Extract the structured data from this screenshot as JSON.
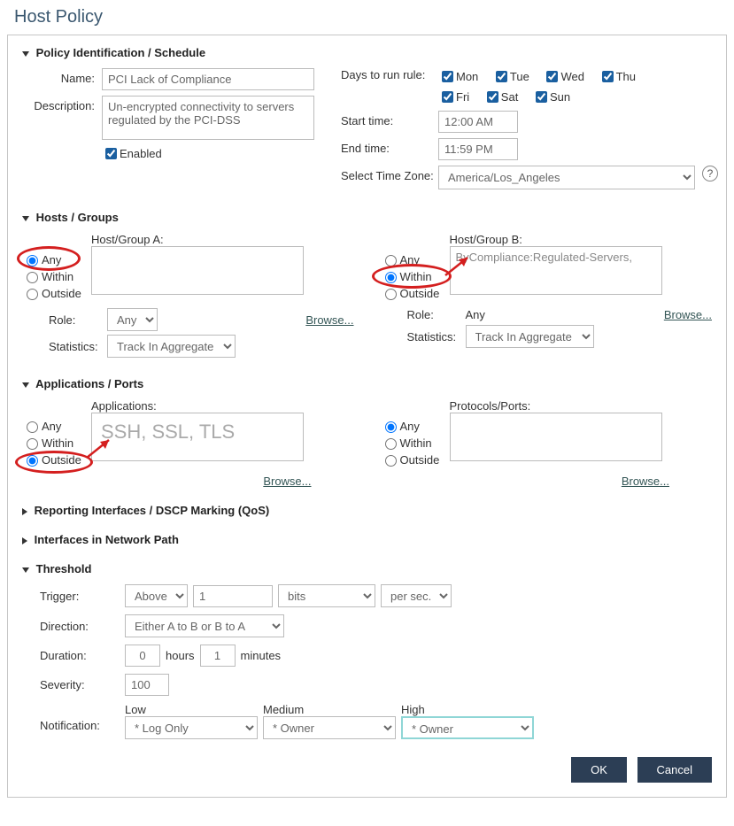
{
  "page_title": "Host Policy",
  "sections": {
    "identification": "Policy Identification / Schedule",
    "hosts": "Hosts / Groups",
    "apps": "Applications / Ports",
    "reporting": "Reporting Interfaces / DSCP Marking (QoS)",
    "interfaces": "Interfaces in Network Path",
    "threshold": "Threshold"
  },
  "identification": {
    "name_label": "Name:",
    "name_value": "PCI Lack of Compliance",
    "description_label": "Description:",
    "description_value": "Un-encrypted connectivity to servers regulated by the PCI-DSS",
    "enabled_label": "Enabled",
    "days_label": "Days to run rule:",
    "days": {
      "mon": "Mon",
      "tue": "Tue",
      "wed": "Wed",
      "thu": "Thu",
      "fri": "Fri",
      "sat": "Sat",
      "sun": "Sun"
    },
    "start_label": "Start time:",
    "start_value": "12:00 AM",
    "end_label": "End time:",
    "end_value": "11:59 PM",
    "tz_label": "Select Time Zone:",
    "tz_value": "America/Los_Angeles"
  },
  "hosts": {
    "groupA_label": "Host/Group A:",
    "groupB_label": "Host/Group B:",
    "groupB_value": "ByCompliance:Regulated-Servers,",
    "opt_any": "Any",
    "opt_within": "Within",
    "opt_outside": "Outside",
    "role_label": "Role:",
    "role_value": "Any",
    "stats_label": "Statistics:",
    "stats_value": "Track In Aggregate",
    "browse": "Browse..."
  },
  "apps": {
    "apps_label": "Applications:",
    "apps_value": "SSH, SSL, TLS",
    "ports_label": "Protocols/Ports:",
    "opt_any": "Any",
    "opt_within": "Within",
    "opt_outside": "Outside",
    "browse": "Browse..."
  },
  "threshold": {
    "trigger_label": "Trigger:",
    "trigger_op": "Above",
    "trigger_val": "1",
    "trigger_unit": "bits",
    "trigger_rate": "per sec.",
    "direction_label": "Direction:",
    "direction_value": "Either A to B or B to A",
    "duration_label": "Duration:",
    "duration_hours": "0",
    "hours_label": "hours",
    "duration_minutes": "1",
    "minutes_label": "minutes",
    "severity_label": "Severity:",
    "severity_value": "100",
    "notification_label": "Notification:",
    "low_label": "Low",
    "low_value": "* Log Only",
    "medium_label": "Medium",
    "medium_value": "* Owner",
    "high_label": "High",
    "high_value": "* Owner"
  },
  "buttons": {
    "ok": "OK",
    "cancel": "Cancel"
  }
}
